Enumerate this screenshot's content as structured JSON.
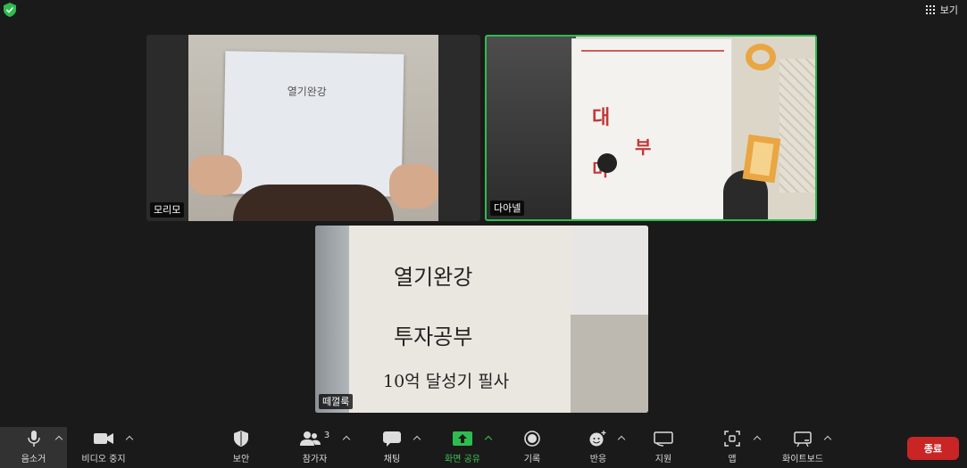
{
  "header": {
    "view_label": "보기"
  },
  "participants": [
    {
      "name": "모리모",
      "paper_text": "열기완강"
    },
    {
      "name": "다아넬",
      "book_title_lines": [
        "대",
        "부",
        "미"
      ]
    },
    {
      "name": "떼껄룩",
      "paper_lines": [
        "열기완강",
        "투자공부",
        "10억 달성기 필사"
      ]
    }
  ],
  "toolbar": {
    "mute": "음소거",
    "video": "비디오 중지",
    "security": "보안",
    "participants": "참가자",
    "participants_count": "3",
    "chat": "채팅",
    "share": "화면 공유",
    "record": "기록",
    "reactions": "반응",
    "support": "지원",
    "apps": "앱",
    "whiteboard": "화이트보드",
    "end": "종료"
  },
  "colors": {
    "accent_green": "#2ebc4f",
    "end_red": "#c92525",
    "background": "#1a1a1a"
  }
}
